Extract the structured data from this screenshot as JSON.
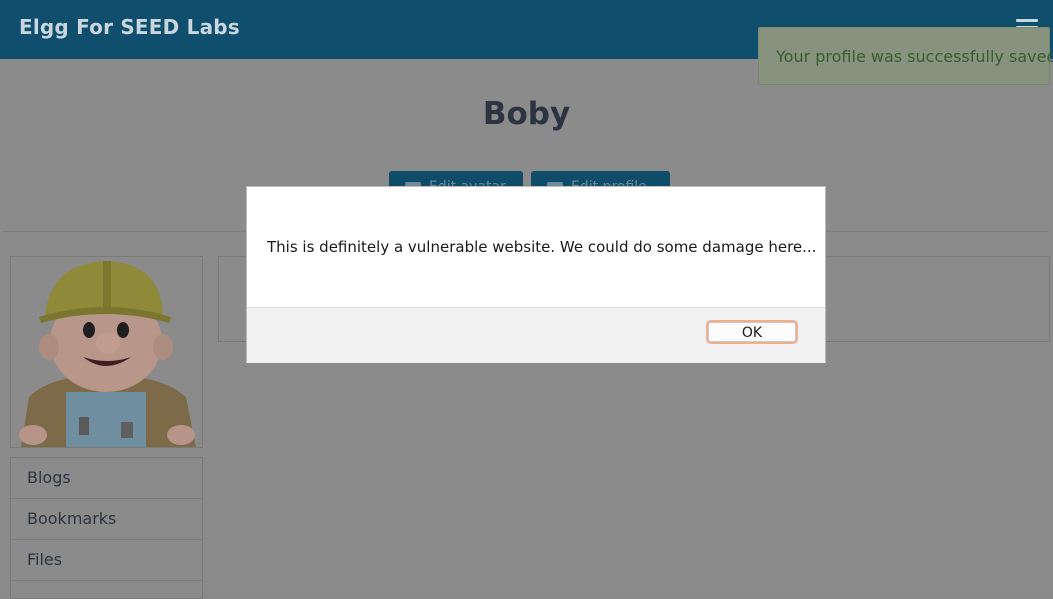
{
  "header": {
    "site_title": "Elgg For SEED Labs",
    "menu_icon": "hamburger-menu-icon"
  },
  "notification": {
    "message": "Your profile was successfully saved."
  },
  "profile": {
    "name": "Boby",
    "buttons": [
      {
        "label": "Edit avatar",
        "icon": "image-icon"
      },
      {
        "label": "Edit profile",
        "icon": "card-icon"
      }
    ],
    "avatar_alt": "Bob the Builder avatar"
  },
  "sidebar": {
    "items": [
      {
        "label": "Blogs"
      },
      {
        "label": "Bookmarks"
      },
      {
        "label": "Files"
      }
    ]
  },
  "alert": {
    "message": "This is definitely a vulnerable website. We could do some damage here...",
    "ok_label": "OK"
  }
}
